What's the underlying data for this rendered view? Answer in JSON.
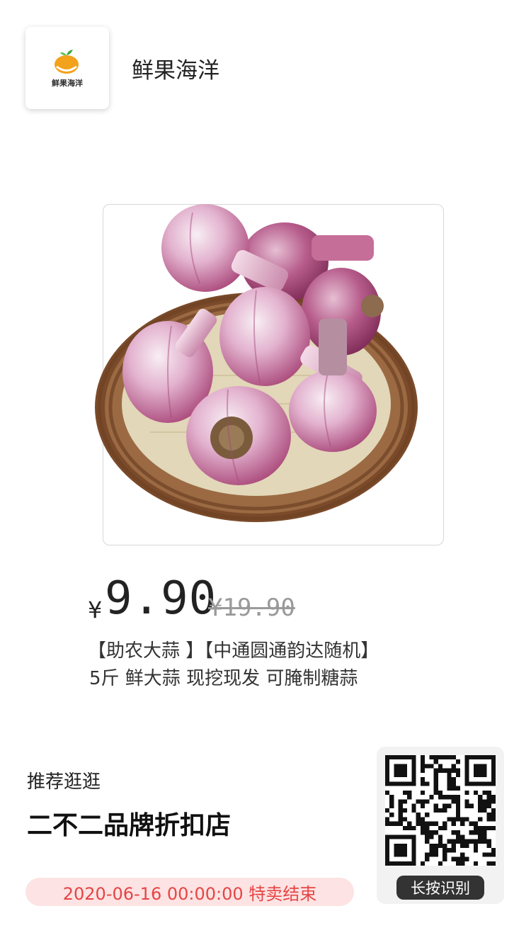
{
  "header": {
    "logo_text": "鲜果海洋",
    "shop_name": "鲜果海洋"
  },
  "product": {
    "image_alt": "purple garlic bulbs in woven basket",
    "currency_symbol": "¥",
    "price": "9.90",
    "original_price": "¥19.90",
    "title_line1": "【助农大蒜 】【中通圆通韵达随机】",
    "title_line2": "5斤 鲜大蒜 现挖现发 可腌制糖蒜"
  },
  "recommend": {
    "label": "推荐逛逛",
    "store_name": "二不二品牌折扣店"
  },
  "sale": {
    "end_text": "2020-06-16 00:00:00 特卖结束"
  },
  "qr": {
    "button_label": "长按识别"
  },
  "colors": {
    "accent_red": "#e64545",
    "badge_bg": "#fde3e3",
    "qr_button_bg": "#333333",
    "logo_orange": "#f2a21b",
    "logo_leaf": "#3aa83a"
  }
}
